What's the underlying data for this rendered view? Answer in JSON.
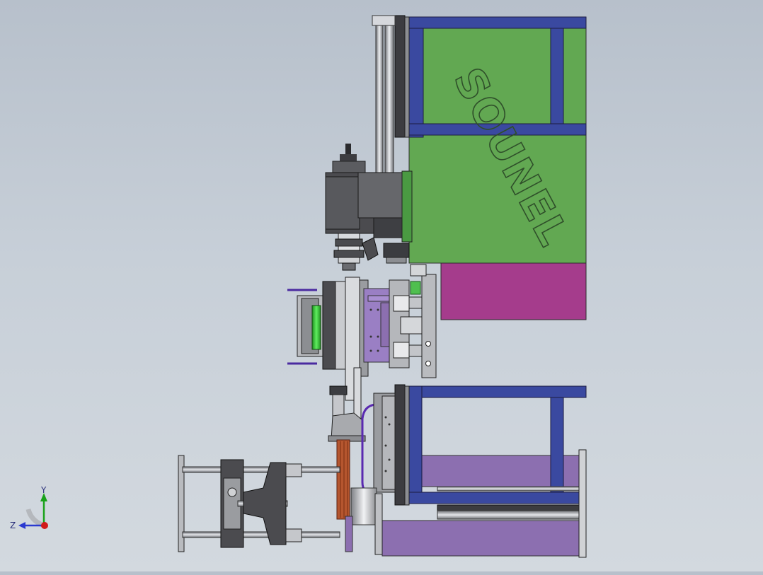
{
  "viewport": {
    "background_top": "#b7c0cb",
    "background_bottom": "#d3d9df"
  },
  "model": {
    "engraving_text": "SOUNEL",
    "colors": {
      "frame_blue": "#3a49a0",
      "panel_green": "#62a852",
      "panel_magenta": "#a53c8c",
      "purple_block": "#8c6fb0",
      "purple_light": "#9a7fc4",
      "steel_dark": "#4b4b4f",
      "steel_mid": "#8f9196",
      "steel_light": "#c9cbcf",
      "copper": "#b5562f",
      "bright_green": "#3bd13b"
    }
  },
  "triad": {
    "x_label": "",
    "y_label": "Y",
    "z_label": "Z",
    "colors": {
      "x": "#d11a1a",
      "y": "#1aa21a",
      "z": "#2a3ad0"
    }
  }
}
